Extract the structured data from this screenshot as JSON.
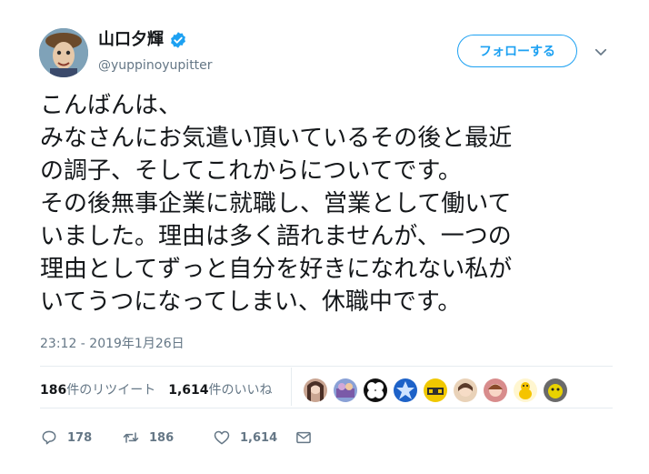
{
  "user": {
    "display_name": "山口夕輝",
    "handle": "@yuppinoyupitter",
    "verified_icon": "verified-badge-icon"
  },
  "follow_button": {
    "label": "フォローする"
  },
  "tweet": {
    "lines": [
      "こんばんは、",
      "みなさんにお気遣い頂いているその後と最近",
      "の調子、そしてこれからについてです。",
      "その後無事企業に就職し、営業として働いて",
      "いました。理由は多く語れませんが、一つの",
      "理由としてずっと自分を好きになれない私が",
      "いてうつになってしまい、休職中です。"
    ],
    "timestamp": "23:12 - 2019年1月26日"
  },
  "stats": {
    "retweets_num": "186",
    "retweets_label": "件のリツイート",
    "likes_num": "1,614",
    "likes_label": "件のいいね"
  },
  "actions": {
    "reply_count": "178",
    "retweet_count": "186",
    "like_count": "1,614"
  },
  "colors": {
    "accent": "#1da1f2",
    "muted": "#657786",
    "text": "#14171a"
  }
}
